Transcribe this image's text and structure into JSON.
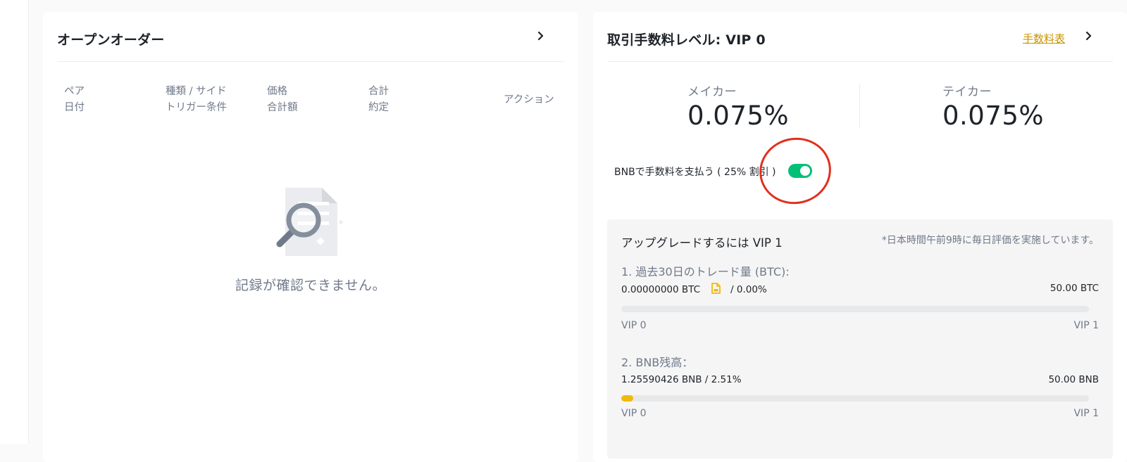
{
  "open_orders": {
    "title": "オープンオーダー",
    "columns": [
      {
        "line1": "ペア",
        "line2": "日付"
      },
      {
        "line1": "種類 / サイド",
        "line2": "トリガー条件"
      },
      {
        "line1": "価格",
        "line2": "合計額"
      },
      {
        "line1": "合計",
        "line2": "約定"
      }
    ],
    "action_header": "アクション",
    "empty_text": "記録が確認できません。"
  },
  "fee_level": {
    "title": "取引手数料レベル: VIP 0",
    "fee_table_link": "手数料表",
    "maker_label": "メイカー",
    "maker_value": "0.075%",
    "taker_label": "テイカー",
    "taker_value": "0.075%",
    "bnb_pay_label": "BNBで手数料を支払う ( 25% 割引 )",
    "bnb_pay_enabled": true,
    "toggle_color": "#02c076",
    "annotation_color": "#e0301e"
  },
  "upgrade": {
    "title": "アップグレードするには VIP 1",
    "note": "*日本時間午前9時に毎日評価を実施しています。",
    "trade_volume": {
      "label": "1. 過去30日のトレード量 (BTC):",
      "current": "0.00000000 BTC",
      "percent": "/ 0.00%",
      "target": "50.00 BTC",
      "progress": 0.0,
      "from_level": "VIP 0",
      "to_level": "VIP 1"
    },
    "bnb_balance": {
      "label": "2. BNB残高：",
      "current": "1.25590426 BNB / 2.51%",
      "target": "50.00 BNB",
      "progress": 0.0251,
      "from_level": "VIP 0",
      "to_level": "VIP 1"
    },
    "accent_color": "#f0b90b"
  }
}
